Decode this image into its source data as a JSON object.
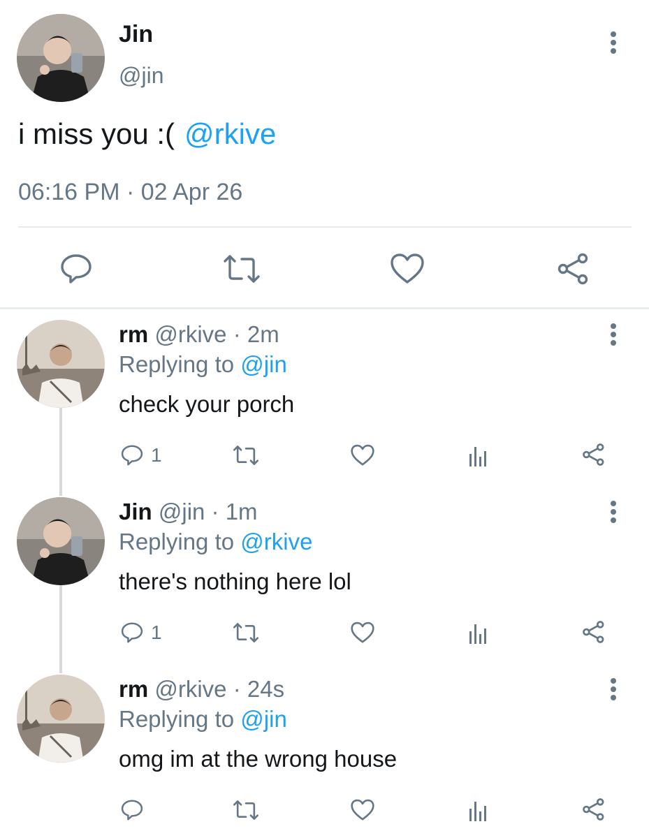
{
  "main_tweet": {
    "name": "Jin",
    "handle": "@jin",
    "text": "i miss you :(",
    "mention": "@rkive",
    "timestamp": "06:16 PM · 02 Apr 26",
    "actions": [
      "reply-icon",
      "retweet-icon",
      "like-icon",
      "share-icon"
    ]
  },
  "replies": [
    {
      "name": "rm",
      "meta": "@rkive · 2m",
      "replying_prefix": "Replying to",
      "replying_to": "@jin",
      "text": "check your porch",
      "reply_count": "1"
    },
    {
      "name": "Jin",
      "meta": "@jin · 1m",
      "replying_prefix": "Replying to",
      "replying_to": "@rkive",
      "text": "there's nothing here lol",
      "reply_count": "1"
    },
    {
      "name": "rm",
      "meta": "@rkive · 24s",
      "replying_prefix": "Replying to",
      "replying_to": "@jin",
      "text": "omg im at the wrong house",
      "reply_count": ""
    }
  ],
  "colors": {
    "accent": "#1da1f2",
    "secondary_text": "#657786",
    "icon": "#657786",
    "divider": "#e6ecf0"
  }
}
